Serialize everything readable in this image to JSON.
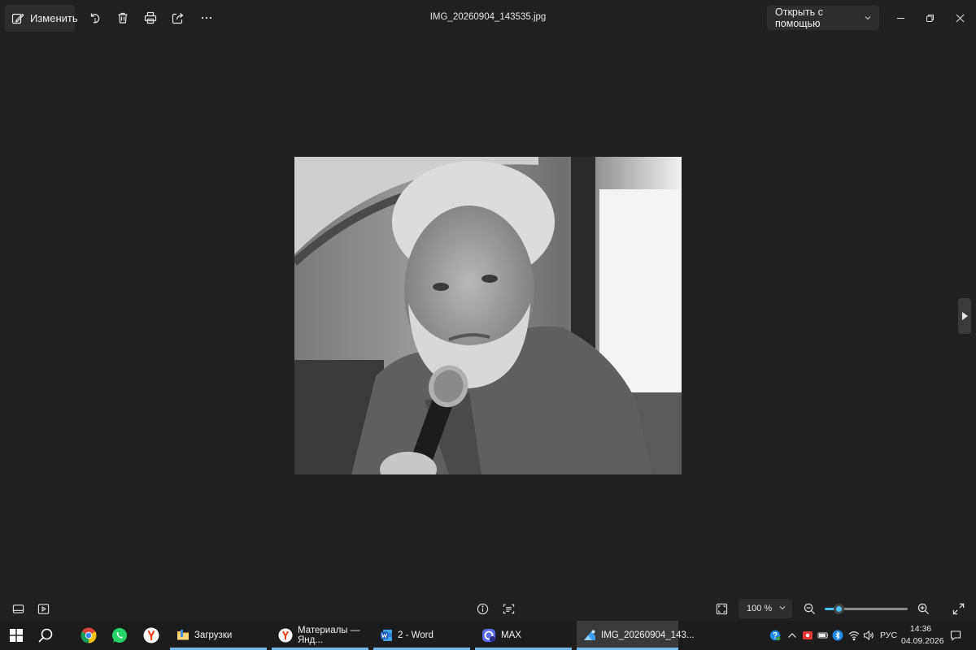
{
  "toolbar": {
    "edit_label": "Изменить",
    "file_name": "IMG_20260904_143535.jpg",
    "open_with_label": "Открыть с помощью",
    "icons": [
      "edit-icon",
      "rotate-icon",
      "delete-icon",
      "print-icon",
      "share-icon",
      "more-icon",
      "minimize-icon",
      "restore-icon",
      "close-icon"
    ]
  },
  "viewer": {
    "image_alt": "Black-and-white portrait photo",
    "zoom_value": "100 %",
    "zoom_level": 0.17
  },
  "taskbar": {
    "apps": [
      {
        "label": "Загрузки",
        "icon": "folder-icon"
      },
      {
        "label": "Материалы — Янд...",
        "icon": "yandex-browser-icon"
      },
      {
        "label": "2 - Word",
        "icon": "word-icon"
      },
      {
        "label": "MAX",
        "icon": "max-messenger-icon"
      },
      {
        "label": "IMG_20260904_143...",
        "icon": "photos-icon"
      }
    ],
    "language": "РУС",
    "time": "14:36",
    "date": "04.09.2026"
  },
  "colors": {
    "background": "#202020",
    "accent": "#4cc2ff",
    "taskbar_indicator": "#76b9ed"
  }
}
